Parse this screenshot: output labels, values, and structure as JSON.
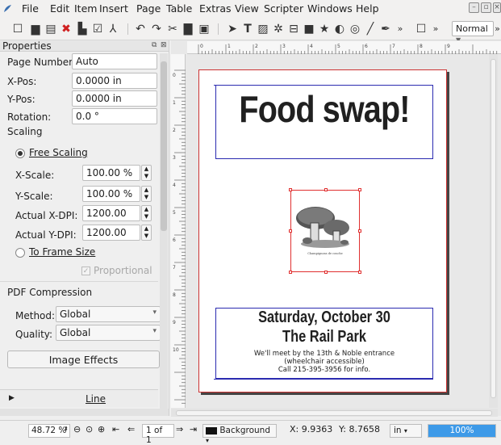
{
  "menubar": {
    "items": [
      {
        "label": "File"
      },
      {
        "label": "Edit"
      },
      {
        "label": "Item"
      },
      {
        "label": "Insert"
      },
      {
        "label": "Page"
      },
      {
        "label": "Table"
      },
      {
        "label": "Extras"
      },
      {
        "label": "View"
      },
      {
        "label": "Scripter"
      },
      {
        "label": "Windows"
      },
      {
        "label": "Help"
      }
    ]
  },
  "toolbar": {
    "mode_select": "Normal",
    "overflow": "»"
  },
  "properties": {
    "title": "Properties",
    "page_number_label": "Page Number:",
    "page_number_value": "Auto",
    "xpos_label": "X-Pos:",
    "xpos_value": "0.0000 in",
    "ypos_label": "Y-Pos:",
    "ypos_value": "0.0000 in",
    "rotation_label": "Rotation:",
    "rotation_value": "0.0 °",
    "scaling_label": "Scaling",
    "free_scaling_label": "Free Scaling",
    "xscale_label": "X-Scale:",
    "xscale_value": "100.00 %",
    "yscale_label": "Y-Scale:",
    "yscale_value": "100.00 %",
    "xdpi_label": "Actual X-DPI:",
    "xdpi_value": "1200.00",
    "ydpi_label": "Actual Y-DPI:",
    "ydpi_value": "1200.00",
    "to_frame_label": "To Frame Size",
    "proportional_label": "Proportional",
    "pdf_label": "PDF Compression",
    "method_label": "Method:",
    "method_value": "Global",
    "quality_label": "Quality:",
    "quality_value": "Global",
    "image_effects_label": "Image Effects",
    "line_label": "Line"
  },
  "document": {
    "title": "Food swap!",
    "date_line": "Saturday, October 30",
    "location_line": "The Rail Park",
    "details_1": "We'll meet by the 13th & Noble entrance",
    "details_2": "(wheelchair accessible)",
    "details_3": "Call 215-395-3956 for info.",
    "image_caption": "Champignons de couche"
  },
  "ruler": {
    "h_ticks": [
      "0",
      "1",
      "2",
      "3",
      "4",
      "5",
      "6",
      "7",
      "8",
      "9"
    ],
    "v_ticks": [
      "0",
      "1",
      "2",
      "3",
      "4",
      "5",
      "6",
      "7",
      "8",
      "9",
      "10"
    ]
  },
  "statusbar": {
    "zoom": "48.72 %",
    "page": "1 of 1",
    "layer": "Background",
    "x_coord": "X: 9.9363",
    "y_coord": "Y: 8.7658",
    "unit": "in",
    "progress": "100%",
    "progress_value": 1.0
  },
  "colors": {
    "accent": "#3d9ae8",
    "frame_red": "#e03030",
    "guide_blue": "#2b2bb0"
  }
}
